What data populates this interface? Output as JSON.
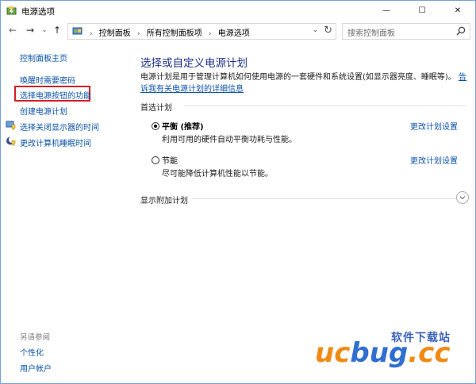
{
  "window": {
    "title": "电源选项",
    "min_glyph": "—",
    "max_glyph": "☐",
    "close_glyph": "✕"
  },
  "nav": {
    "back_glyph": "←",
    "forward_glyph": "→",
    "recent_glyph": "⌄",
    "up_glyph": "↑",
    "breadcrumbs": [
      "控制面板",
      "所有控制面板项",
      "电源选项"
    ],
    "separator": "›",
    "dropdown_glyph": "⌄",
    "refresh_glyph": "↻",
    "search_placeholder": "搜索控制面板"
  },
  "left_pane": {
    "home": "控制面板主页",
    "links": [
      "唤醒时需要密码",
      "选择电源按钮的功能",
      "创建电源计划",
      "选择关闭显示器的时间",
      "更改计算机睡眠时间"
    ],
    "highlighted_index": 1,
    "see_also_label": "另请参阅",
    "see_also_links": [
      "个性化",
      "用户帐户"
    ]
  },
  "main": {
    "title": "选择或自定义电源计划",
    "description": "电源计划是用于管理计算机如何使用电源的一套硬件和系统设置(如显示器亮度、睡眠等)。",
    "description_link": "告诉我有关电源计划的详细信息",
    "preferred_label": "首选计划",
    "plans": [
      {
        "name": "平衡 (推荐)",
        "description": "利用可用的硬件自动平衡功耗与性能。",
        "checked": true,
        "change_link": "更改计划设置"
      },
      {
        "name": "节能",
        "description": "尽可能降低计算机性能以节能。",
        "checked": false,
        "change_link": "更改计划设置"
      }
    ],
    "extra_plans_label": "显示附加计划"
  },
  "watermark": {
    "text_cn": "软件下载站",
    "logo_uc": "uc",
    "logo_bug": "bug",
    "logo_cc": ".cc"
  },
  "colors": {
    "link": "#0b53a6",
    "title": "#1e3287",
    "highlight": "#d21f26"
  }
}
